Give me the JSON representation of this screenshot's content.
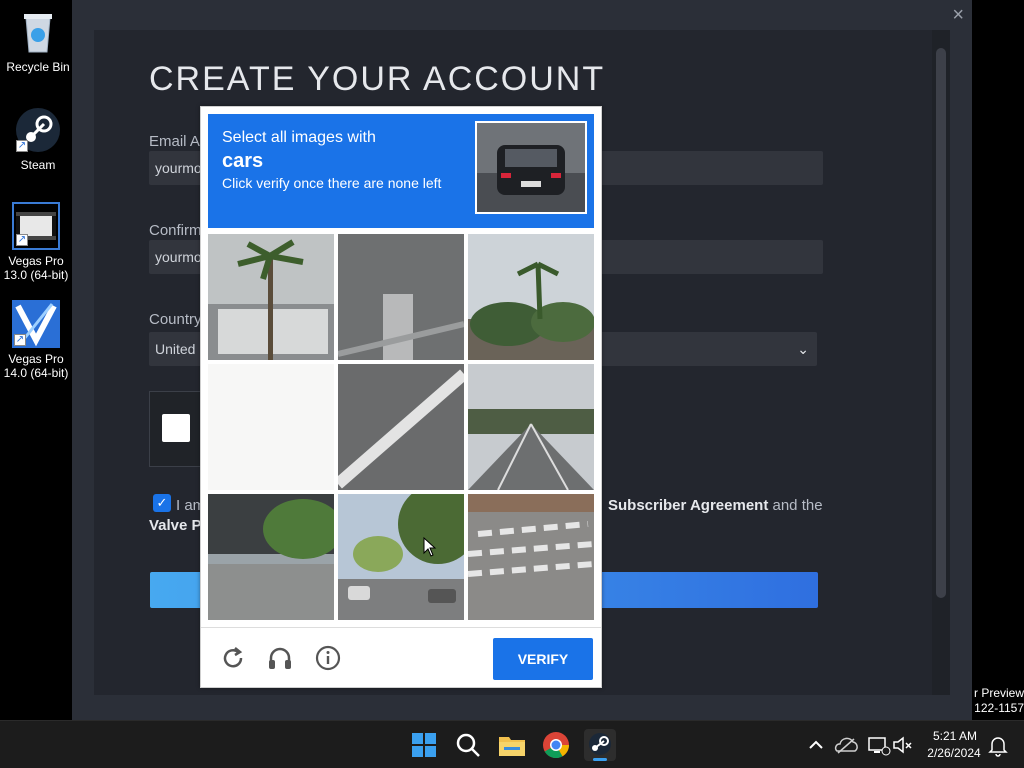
{
  "desktop": {
    "icons": [
      {
        "label": "Recycle Bin"
      },
      {
        "label": "Steam"
      },
      {
        "label": "Vegas Pro 13.0 (64-bit)"
      },
      {
        "label": "Vegas Pro 14.0 (64-bit)"
      }
    ],
    "preview_text_line1": "r Preview",
    "preview_text_line2": "122-1157"
  },
  "steam": {
    "title": "CREATE YOUR ACCOUNT",
    "close_glyph": "×",
    "email_label": "Email Ac",
    "email_value": "yourmo",
    "confirm_label": "Confirm",
    "confirm_value": "yourmo",
    "country_label": "Country",
    "country_value": "United",
    "agree_text": "I am",
    "subscriber_agreement": "Subscriber Agreement",
    "and_the": " and the",
    "valve_privacy": "Valve Pr"
  },
  "captcha": {
    "instruction_line1": "Select all images with",
    "target": "cars",
    "instruction_line3": "Click verify once there are none left",
    "verify_label": "VERIFY",
    "accent": "#1a73e8"
  },
  "taskbar": {
    "time": "5:21 AM",
    "date": "2/26/2024"
  }
}
